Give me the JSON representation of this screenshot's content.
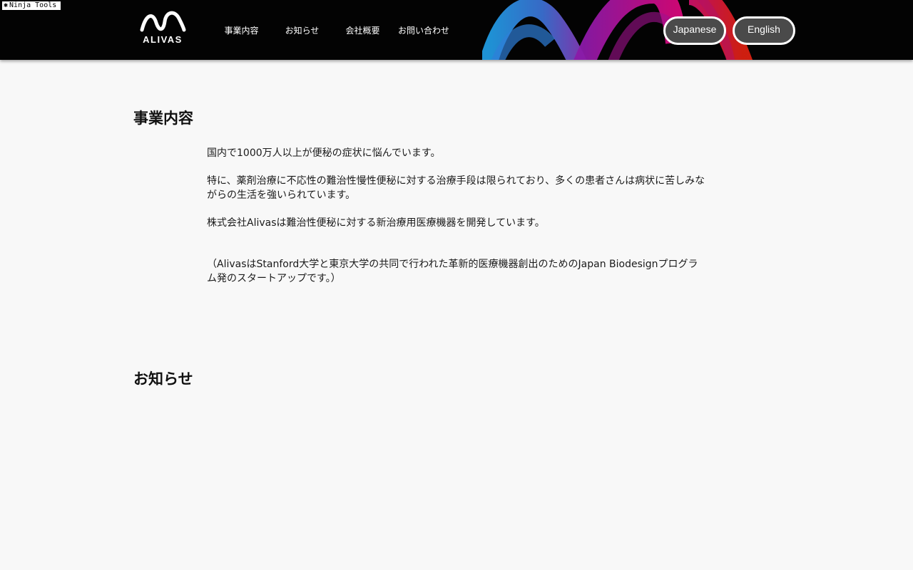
{
  "toolbar_badge": {
    "label": "Ninja Tools",
    "icon": "ninja-star-icon"
  },
  "header": {
    "logo_text": "ALIVAS",
    "nav": [
      {
        "label": "事業内容"
      },
      {
        "label": "お知らせ"
      },
      {
        "label": "会社概要"
      },
      {
        "label": "お問い合わせ"
      }
    ],
    "lang_buttons": {
      "japanese": "Japanese",
      "english": "English"
    },
    "colors": {
      "bg": "#030303",
      "wave_blue": "#2aa8e8",
      "wave_magenta": "#c0108a",
      "wave_red": "#d11a1a"
    }
  },
  "business": {
    "title": "事業内容",
    "paragraphs": [
      "国内で1000万人以上が便秘の症状に悩んでいます。",
      "特に、薬剤治療に不応性の難治性慢性便秘に対する治療手段は限られており、多くの患者さんは病状に苦しみながらの生活を強いられています。",
      "株式会社Alivasは難治性便秘に対する新治療用医療機器を開発しています。",
      "（AlivasはStanford大学と東京大学の共同で行われた革新的医療機器創出のためのJapan Biodesignプログラム発のスタートアップです。）"
    ]
  },
  "news": {
    "title": "お知らせ"
  }
}
